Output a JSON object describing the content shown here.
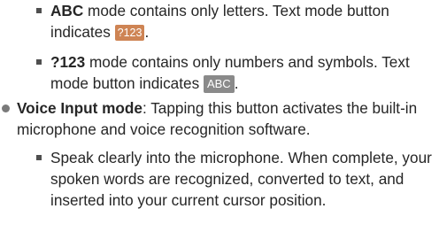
{
  "items": {
    "abc_mode": {
      "term": "ABC",
      "text": " mode contains only letters. Text mode button indicates ",
      "key_label": "?123",
      "end": "."
    },
    "num_mode": {
      "term": "?123",
      "text": " mode contains only numbers and symbols. Text mode button indicates ",
      "key_label": "ABC",
      "end": "."
    },
    "voice_mode": {
      "term": "Voice Input mode",
      "text": ": Tapping this button activates the built-in microphone and voice recognition software."
    },
    "speak": {
      "text": "Speak clearly into the microphone. When complete, your spoken words are recognized, converted to text, and inserted into your current cursor position."
    }
  },
  "colors": {
    "text": "#262626",
    "num_key_bg": "#ce8454",
    "abc_key_bg": "#8a8a8a"
  }
}
